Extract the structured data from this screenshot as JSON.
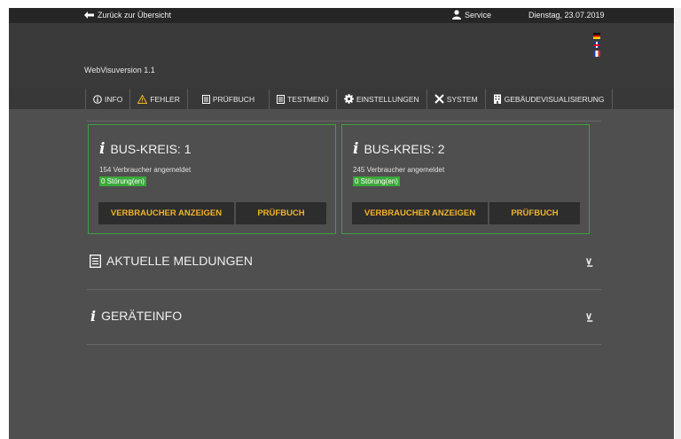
{
  "topbar": {
    "back": "Zurück zur Übersicht",
    "service": "Service",
    "date": "Dienstag, 23.07.2019"
  },
  "header": {
    "version": "WebVisuversion 1.1",
    "languages": [
      "de",
      "en",
      "fr"
    ]
  },
  "nav": [
    {
      "label": "INFO",
      "icon": "info-icon"
    },
    {
      "label": "FEHLER",
      "icon": "warning-icon"
    },
    {
      "label": "PRÜFBUCH",
      "icon": "book-icon"
    },
    {
      "label": "TESTMENÜ",
      "icon": "book-icon"
    },
    {
      "label": "EINSTELLUNGEN",
      "icon": "gear-icon"
    },
    {
      "label": "SYSTEM",
      "icon": "tools-icon"
    },
    {
      "label": "GEBÄUDEVISUALISIERUNG",
      "icon": "building-icon"
    }
  ],
  "cards": [
    {
      "title": "BUS-KREIS: 1",
      "count": "154 Verbraucher angemeldet",
      "status": "0 Störung(en)",
      "btn_show": "VERBRAUCHER ANZEIGEN",
      "btn_book": "PRÜFBUCH"
    },
    {
      "title": "BUS-KREIS: 2",
      "count": "245 Verbraucher angemeldet",
      "status": "0 Störung(en)",
      "btn_show": "VERBRAUCHER ANZEIGEN",
      "btn_book": "PRÜFBUCH"
    }
  ],
  "sections": {
    "messages": "AKTUELLE MELDUNGEN",
    "device_info": "GERÄTEINFO"
  },
  "colors": {
    "accent": "#f0b429",
    "ok_green": "#3aaa3a",
    "card_border": "#3fa03f"
  }
}
